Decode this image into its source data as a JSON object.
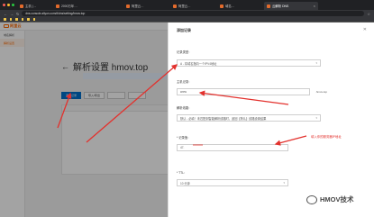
{
  "browser": {
    "tabs": [
      {
        "label": "主机 | ...",
        "active": false
      },
      {
        "label": "2000万年…",
        "active": false
      },
      {
        "label": "阿里云…",
        "active": false
      },
      {
        "label": "阿里云…",
        "active": false
      },
      {
        "label": "域名…",
        "active": false
      },
      {
        "label": "云解析 DNS",
        "active": true
      }
    ],
    "url": "dns.console.aliyun.com/#/dns/setting/hmov.top"
  },
  "app": {
    "logo": "阿里云",
    "sidebar": [
      {
        "label": "域名解析",
        "active": false
      },
      {
        "label": "解析设置",
        "active": true
      },
      {
        "label": "",
        "active": false
      },
      {
        "label": "",
        "active": false
      },
      {
        "label": "",
        "active": false
      }
    ],
    "page_title": "解析设置 hmov.top",
    "toolbar": {
      "add_record": "添加记录",
      "import": "导入/导出",
      "btn3": "",
      "btn4": ""
    }
  },
  "dialog": {
    "title": "添加记录",
    "record_type_label": "记录类型：",
    "record_type_value": "A - 将域名指向一个IPV4地址",
    "host_label": "主机记录：",
    "host_value": "www",
    "host_suffix": ".hmov.top",
    "line_label": "解析线路：",
    "line_value": "默认 - 必填！未匹配到智能解析线路时，返回【默认】线路设置结果",
    "value_label": "* 记录值：",
    "value_value": "47.",
    "ttl_label": "* TTL：",
    "ttl_value": "10 分钟"
  },
  "annotation": "填入你的服务器IP地址",
  "watermark": "HMOV技术",
  "colors": {
    "accent": "#ff6a00",
    "primary": "#0070cc",
    "arrow": "#e3312d"
  }
}
